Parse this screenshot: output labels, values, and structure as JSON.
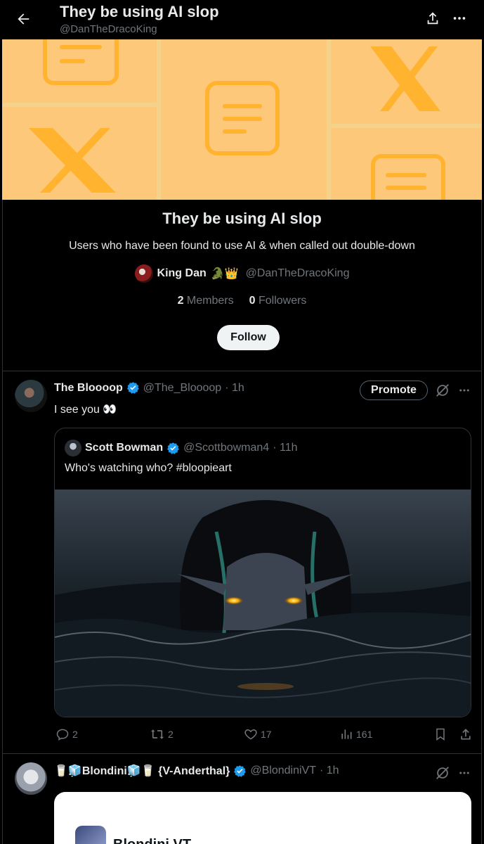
{
  "header": {
    "title": "They be using AI slop",
    "handle": "@DanTheDracoKing"
  },
  "list": {
    "name": "They be using AI slop",
    "description": "Users who have been found to use AI & when called out double-down",
    "owner_name": "King Dan",
    "owner_emoji": "🐊👑",
    "owner_handle": "@DanTheDracoKing",
    "members_count": "2",
    "members_label": "Members",
    "followers_count": "0",
    "followers_label": "Followers",
    "follow_label": "Follow"
  },
  "tweets": [
    {
      "name": "The Bloooop",
      "handle": "@The_Bloooop",
      "time": "· 1h",
      "text": "I see you 👀",
      "promote_label": "Promote",
      "quote": {
        "name": "Scott Bowman",
        "handle": "@Scottbowman4",
        "time": "· 11h",
        "text": "Who's watching who?  #bloopieart"
      },
      "actions": {
        "replies": "2",
        "reposts": "2",
        "likes": "17",
        "views": "161"
      }
    },
    {
      "name": "🥛🧊Blondini🧊🥛 {V-Anderthal}",
      "handle": "@BlondiniVT",
      "time": "· 1h",
      "card_name": "Blondini VT"
    }
  ],
  "colors": {
    "background": "#000000",
    "text": "#e7e9ea",
    "muted": "#71767b",
    "verified": "#1d9bf0",
    "banner_tile": "#fdc87a",
    "banner_icon": "#ffb32e"
  }
}
